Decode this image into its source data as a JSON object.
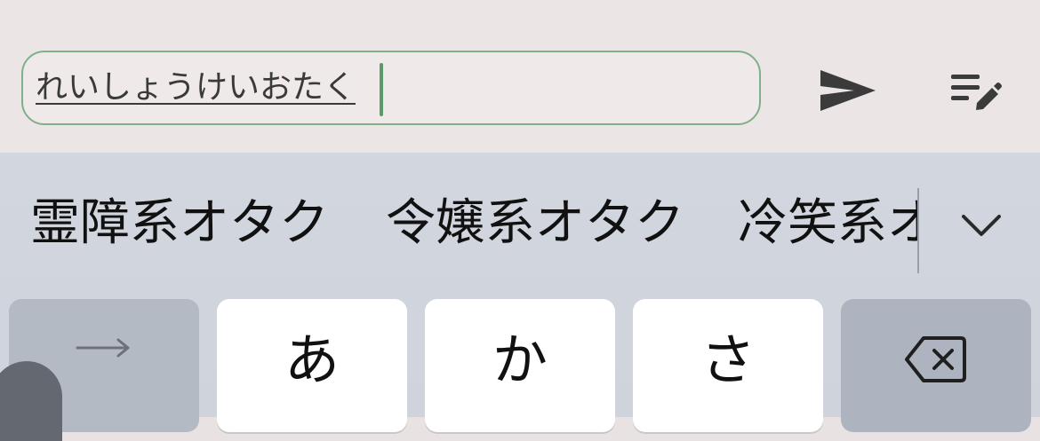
{
  "composer": {
    "input_value": "れいしょうけいおたく",
    "send_icon": "send-icon",
    "notes_icon": "edit-notes-icon",
    "accent_color": "#7fb08a"
  },
  "keyboard": {
    "candidates": [
      "霊障系オタク",
      "令嬢系オタク",
      "冷笑系オ"
    ],
    "expand_icon": "chevron-down-icon",
    "keys": {
      "next_icon": "arrow-right-icon",
      "a": "あ",
      "ka": "か",
      "sa": "さ",
      "delete_icon": "delete-backspace-icon"
    }
  }
}
